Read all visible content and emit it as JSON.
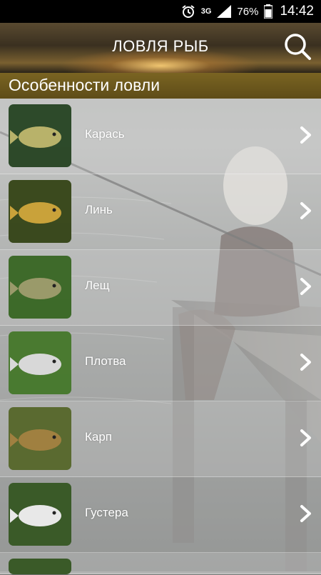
{
  "status_bar": {
    "network": "3G",
    "battery": "76%",
    "time": "14:42"
  },
  "header": {
    "title": "ЛОВЛЯ РЫБ"
  },
  "section": {
    "title": "Особенности ловли"
  },
  "fish_list": [
    {
      "label": "Карась",
      "thumb_colors": [
        "#2d4a2a",
        "#b8b26a"
      ]
    },
    {
      "label": "Линь",
      "thumb_colors": [
        "#3b4a1e",
        "#c9a23a"
      ]
    },
    {
      "label": "Лещ",
      "thumb_colors": [
        "#3e6a2a",
        "#9a9a6a"
      ]
    },
    {
      "label": "Плотва",
      "thumb_colors": [
        "#4a7a30",
        "#d8d8d8"
      ]
    },
    {
      "label": "Карп",
      "thumb_colors": [
        "#5a6a30",
        "#a08040"
      ]
    },
    {
      "label": "Густера",
      "thumb_colors": [
        "#3a5a28",
        "#e8e8e8"
      ]
    }
  ]
}
